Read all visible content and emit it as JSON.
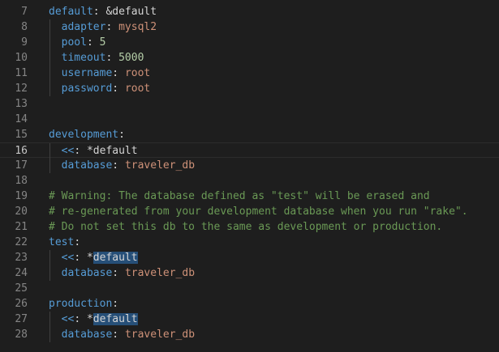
{
  "editor": {
    "lines": [
      {
        "num": "7",
        "tokens": [
          {
            "t": "default",
            "c": "k"
          },
          {
            "t": ": ",
            "c": "p"
          },
          {
            "t": "&default",
            "c": "a"
          }
        ]
      },
      {
        "num": "8",
        "tokens": [
          {
            "t": "  ",
            "c": "p"
          },
          {
            "t": "adapter",
            "c": "k"
          },
          {
            "t": ": ",
            "c": "p"
          },
          {
            "t": "mysql2",
            "c": "s"
          }
        ]
      },
      {
        "num": "9",
        "tokens": [
          {
            "t": "  ",
            "c": "p"
          },
          {
            "t": "pool",
            "c": "k"
          },
          {
            "t": ": ",
            "c": "p"
          },
          {
            "t": "5",
            "c": "n"
          }
        ]
      },
      {
        "num": "10",
        "tokens": [
          {
            "t": "  ",
            "c": "p"
          },
          {
            "t": "timeout",
            "c": "k"
          },
          {
            "t": ": ",
            "c": "p"
          },
          {
            "t": "5000",
            "c": "n"
          }
        ]
      },
      {
        "num": "11",
        "tokens": [
          {
            "t": "  ",
            "c": "p"
          },
          {
            "t": "username",
            "c": "k"
          },
          {
            "t": ": ",
            "c": "p"
          },
          {
            "t": "root",
            "c": "s"
          }
        ]
      },
      {
        "num": "12",
        "tokens": [
          {
            "t": "  ",
            "c": "p"
          },
          {
            "t": "password",
            "c": "k"
          },
          {
            "t": ": ",
            "c": "p"
          },
          {
            "t": "root",
            "c": "s"
          }
        ]
      },
      {
        "num": "13",
        "tokens": []
      },
      {
        "num": "14",
        "tokens": []
      },
      {
        "num": "15",
        "tokens": [
          {
            "t": "development",
            "c": "k"
          },
          {
            "t": ":",
            "c": "p"
          }
        ]
      },
      {
        "num": "16",
        "current": true,
        "tokens": [
          {
            "t": "  ",
            "c": "p"
          },
          {
            "t": "<<",
            "c": "k"
          },
          {
            "t": ": ",
            "c": "p"
          },
          {
            "t": "*",
            "c": "p"
          },
          {
            "t": "default",
            "c": "a"
          }
        ]
      },
      {
        "num": "17",
        "tokens": [
          {
            "t": "  ",
            "c": "p"
          },
          {
            "t": "database",
            "c": "k"
          },
          {
            "t": ": ",
            "c": "p"
          },
          {
            "t": "traveler_db",
            "c": "s"
          }
        ]
      },
      {
        "num": "18",
        "tokens": []
      },
      {
        "num": "19",
        "tokens": [
          {
            "t": "# Warning: The database defined as \"test\" will be erased and",
            "c": "c"
          }
        ]
      },
      {
        "num": "20",
        "tokens": [
          {
            "t": "# re-generated from your development database when you run \"rake\".",
            "c": "c"
          }
        ]
      },
      {
        "num": "21",
        "tokens": [
          {
            "t": "# Do not set this db to the same as development or production.",
            "c": "c"
          }
        ]
      },
      {
        "num": "22",
        "tokens": [
          {
            "t": "test",
            "c": "k"
          },
          {
            "t": ":",
            "c": "p"
          }
        ]
      },
      {
        "num": "23",
        "tokens": [
          {
            "t": "  ",
            "c": "p"
          },
          {
            "t": "<<",
            "c": "k"
          },
          {
            "t": ": ",
            "c": "p"
          },
          {
            "t": "*",
            "c": "p"
          },
          {
            "t": "default",
            "c": "hl"
          }
        ]
      },
      {
        "num": "24",
        "tokens": [
          {
            "t": "  ",
            "c": "p"
          },
          {
            "t": "database",
            "c": "k"
          },
          {
            "t": ": ",
            "c": "p"
          },
          {
            "t": "traveler_db",
            "c": "s"
          }
        ]
      },
      {
        "num": "25",
        "tokens": []
      },
      {
        "num": "26",
        "tokens": [
          {
            "t": "production",
            "c": "k"
          },
          {
            "t": ":",
            "c": "p"
          }
        ]
      },
      {
        "num": "27",
        "tokens": [
          {
            "t": "  ",
            "c": "p"
          },
          {
            "t": "<<",
            "c": "k"
          },
          {
            "t": ": ",
            "c": "p"
          },
          {
            "t": "*",
            "c": "p"
          },
          {
            "t": "default",
            "c": "hl"
          }
        ]
      },
      {
        "num": "28",
        "tokens": [
          {
            "t": "  ",
            "c": "p"
          },
          {
            "t": "database",
            "c": "k"
          },
          {
            "t": ": ",
            "c": "p"
          },
          {
            "t": "traveler_db",
            "c": "s"
          }
        ]
      }
    ]
  },
  "colors": {
    "background": "#1e1e1e",
    "key": "#569cd6",
    "string": "#ce9178",
    "number": "#b5cea8",
    "comment": "#6a9955",
    "line_number": "#858585",
    "highlight": "#264f78"
  }
}
